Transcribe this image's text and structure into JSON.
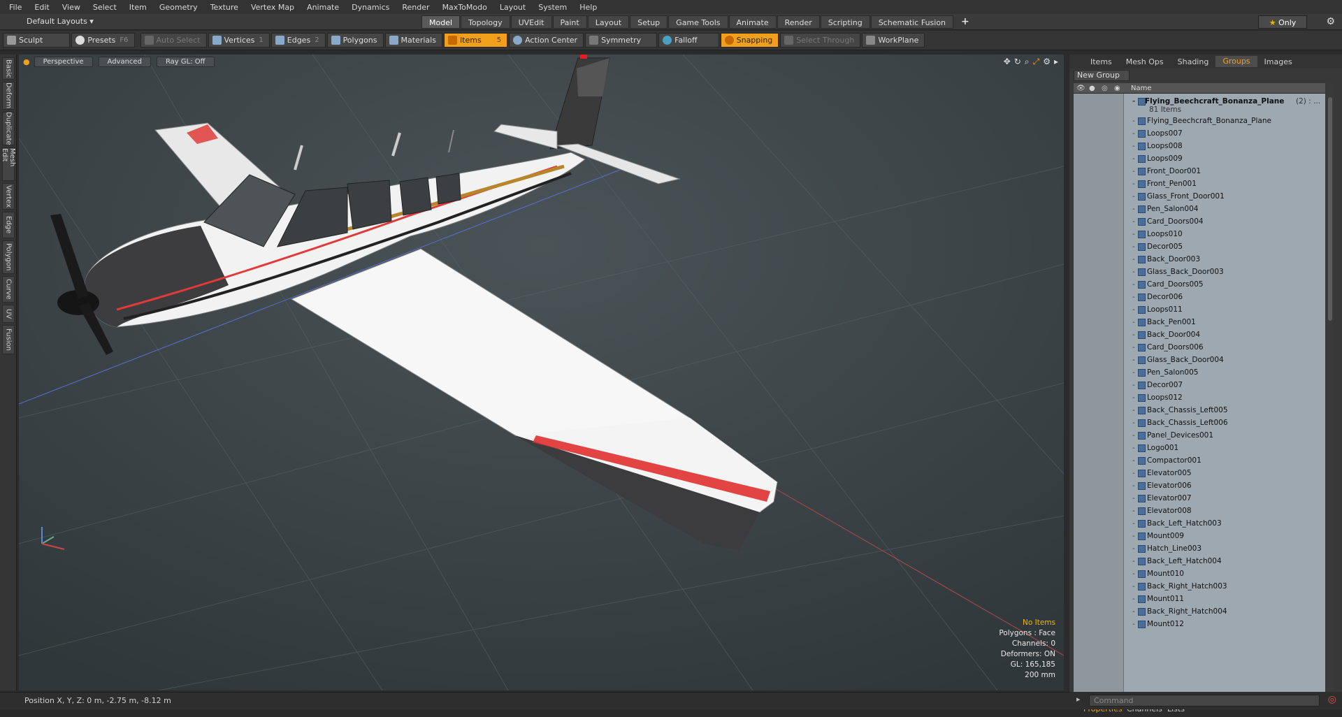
{
  "menu": [
    "File",
    "Edit",
    "View",
    "Select",
    "Item",
    "Geometry",
    "Texture",
    "Vertex Map",
    "Animate",
    "Dynamics",
    "Render",
    "MaxToModo",
    "Layout",
    "System",
    "Help"
  ],
  "layouts_label": "Default Layouts ▾",
  "tabs": [
    "Model",
    "Topology",
    "UVEdit",
    "Paint",
    "Layout",
    "Setup",
    "Game Tools",
    "Animate",
    "Render",
    "Scripting",
    "Schematic Fusion"
  ],
  "active_tab": "Model",
  "only_label": "Only",
  "toolbar": {
    "sculpt": "Sculpt",
    "presets": "Presets",
    "presets_key": "F6",
    "auto_select": "Auto Select",
    "vertices": "Vertices",
    "vertices_num": "1",
    "edges": "Edges",
    "edges_num": "2",
    "polygons": "Polygons",
    "materials": "Materials",
    "items": "Items",
    "items_num": "5",
    "action_center": "Action Center",
    "symmetry": "Symmetry",
    "falloff": "Falloff",
    "snapping": "Snapping",
    "select_through": "Select Through",
    "workplane": "WorkPlane"
  },
  "left_tabs": [
    "Basic",
    "Deform",
    "Duplicate",
    "Mesh Edit",
    "Vertex",
    "Edge",
    "Polygon",
    "Curve",
    "UV",
    "Fusion"
  ],
  "viewport": {
    "view": "Perspective",
    "shading": "Advanced",
    "raygl": "Ray GL: Off",
    "stats": {
      "selection": "No Items",
      "mode": "Polygons : Face",
      "channels": "Channels: 0",
      "deformers": "Deformers: ON",
      "gl": "GL: 165,185",
      "scale": "200 mm"
    }
  },
  "status": "Position X, Y, Z:   0 m, -2.75 m, -8.12 m",
  "right_tabs": [
    "Items",
    "Mesh Ops",
    "Shading",
    "Groups",
    "Images"
  ],
  "active_right_tab": "Groups",
  "new_group": "New Group",
  "list_header": "Name",
  "group": {
    "name": "Flying_Beechcraft_Bonanza_Plane",
    "count": "(2) : ...",
    "items": "81 Items"
  },
  "items": [
    "Flying_Beechcraft_Bonanza_Plane",
    "Loops007",
    "Loops008",
    "Loops009",
    "Front_Door001",
    "Front_Pen001",
    "Glass_Front_Door001",
    "Pen_Salon004",
    "Card_Doors004",
    "Loops010",
    "Decor005",
    "Back_Door003",
    "Glass_Back_Door003",
    "Card_Doors005",
    "Decor006",
    "Loops011",
    "Back_Pen001",
    "Back_Door004",
    "Card_Doors006",
    "Glass_Back_Door004",
    "Pen_Salon005",
    "Decor007",
    "Loops012",
    "Back_Chassis_Left005",
    "Back_Chassis_Left006",
    "Panel_Devices001",
    "Logo001",
    "Compactor001",
    "Elevator005",
    "Elevator006",
    "Elevator007",
    "Elevator008",
    "Back_Left_Hatch003",
    "Mount009",
    "Hatch_Line003",
    "Back_Left_Hatch004",
    "Mount010",
    "Back_Right_Hatch003",
    "Mount011",
    "Back_Right_Hatch004",
    "Mount012"
  ],
  "prop_tabs": [
    "Properties",
    "Channels",
    "Lists"
  ],
  "command_placeholder": "Command"
}
